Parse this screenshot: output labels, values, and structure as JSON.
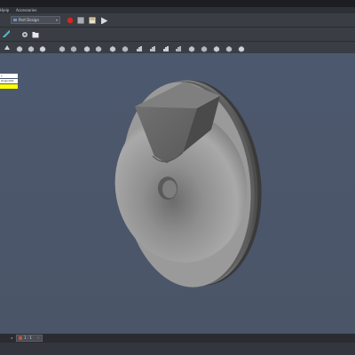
{
  "menubar": {
    "items": [
      "Hjelp",
      "Accessories"
    ]
  },
  "workbench": {
    "selected": "Part Design"
  },
  "tree": {
    "items": [
      {
        "label": "y",
        "style": "white"
      },
      {
        "label": "Origin001",
        "style": "white"
      },
      {
        "label": "",
        "style": "yellow"
      }
    ]
  },
  "tabs": {
    "active_label": "1 : 1",
    "close_glyph": "×"
  },
  "icons": {
    "record": "record-macro-icon",
    "stop": "stop-macro-icon",
    "edit": "edit-macro-icon",
    "run": "run-macro-icon"
  },
  "colors": {
    "record": "#d62525",
    "viewport_top": "#4c586e",
    "model_shade": "#8e8e8e",
    "tree_selected": "#ffff00"
  }
}
